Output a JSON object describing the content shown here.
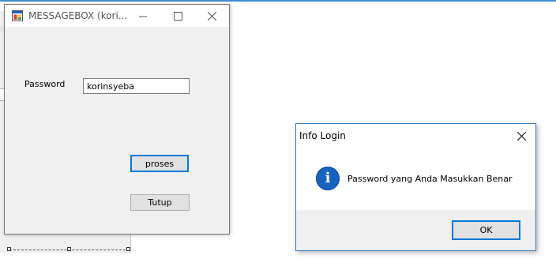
{
  "main_window": {
    "title": "MESSAGEBOX (kori...",
    "password_label": "Password",
    "password_value": "korinsyeba",
    "proses_label": "proses",
    "tutup_label": "Tutup"
  },
  "dialog": {
    "title": "Info Login",
    "message": "Password yang Anda Masukkan Benar",
    "ok_label": "OK",
    "icon": "info-icon"
  },
  "colors": {
    "accent": "#0078d7",
    "info_icon": "#1565c0",
    "dialog_border": "#3a7cc9"
  }
}
